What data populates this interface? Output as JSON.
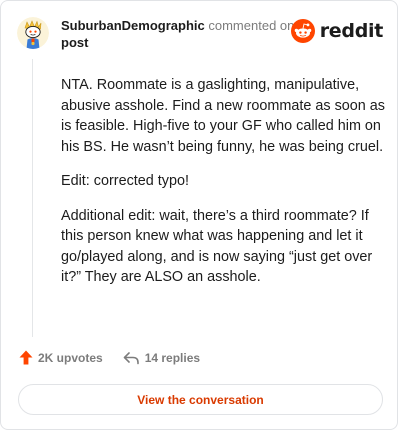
{
  "header": {
    "username": "SuburbanDemographic",
    "action": "commented on",
    "target": "post"
  },
  "brand": {
    "name": "reddit",
    "color": "#ff4500"
  },
  "comment": {
    "paragraphs": [
      "NTA. Roommate is a gaslighting, manipulative, abusive asshole. Find a new roommate as soon as is feasible. High-five to your GF who called him on his BS. He wasn’t being funny, he was being cruel.",
      "Edit: corrected typo!",
      "Additional edit: wait, there’s a third roommate? If this person knew what was happening and let it go/played along, and is now saying “just get over it?” They are ALSO an asshole."
    ]
  },
  "stats": {
    "upvotes": "2K upvotes",
    "replies": "14 replies",
    "upvote_color": "#ff4500"
  },
  "cta": {
    "label": "View the conversation",
    "color": "#d93a00"
  },
  "icons": {
    "avatar": "snoo-avatar",
    "logo": "reddit-snoo-icon",
    "upvote": "upvote-arrow-icon",
    "reply": "reply-arrow-icon"
  }
}
